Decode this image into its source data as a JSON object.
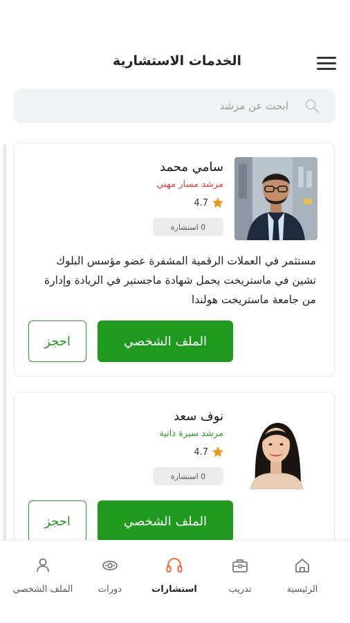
{
  "header": {
    "title": "الخدمات الاستشارية",
    "menu_icon": "hamburger-menu-icon"
  },
  "search": {
    "placeholder": "ابحث عن مرشد",
    "icon": "search-icon"
  },
  "colors": {
    "primary_green": "#1f9a1f",
    "role_red": "#e0413a",
    "role_green": "#2a9a2a",
    "star": "#e89a1c",
    "active_nav": "#f26a3c"
  },
  "mentors": [
    {
      "name": "سامي محمد",
      "role": "مرشد مسار مهني",
      "role_color": "#e0413a",
      "rating": "4.7",
      "consultations": "0 استشارة",
      "bio": "مستثمر في العملات الرقمية المشفرة عضو مؤسس البلوك تشين في ماستريخت يحمل شهادة ماجستير في الريادة وإدارة من جامعة ماستريخت هولندا",
      "profile_label": "الملف الشخصي",
      "book_label": "احجز"
    },
    {
      "name": "نوف سعد",
      "role": "مرشد سيرة ذاتية",
      "role_color": "#2a9a2a",
      "rating": "4.7",
      "consultations": "0 استشارة",
      "profile_label": "الملف الشخصي",
      "book_label": "احجز"
    }
  ],
  "bottom_nav": [
    {
      "label": "الرئيسية",
      "icon": "home-icon",
      "active": false
    },
    {
      "label": "تدريب",
      "icon": "briefcase-icon",
      "active": false
    },
    {
      "label": "استشارات",
      "icon": "headphones-icon",
      "active": true
    },
    {
      "label": "دورات",
      "icon": "webcam-icon",
      "active": false
    },
    {
      "label": "الملف الشخصي",
      "icon": "user-icon",
      "active": false
    }
  ]
}
